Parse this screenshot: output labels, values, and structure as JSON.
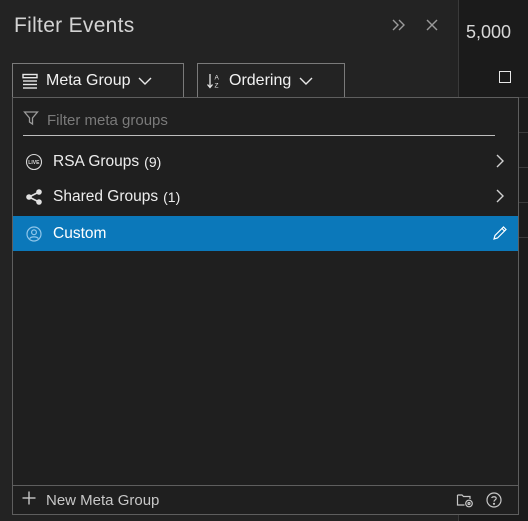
{
  "panel": {
    "title": "Filter Events",
    "expand_icon": "double-chevron-right-icon",
    "close_icon": "close-icon"
  },
  "background": {
    "count_text": "5,000"
  },
  "toolbar": {
    "meta_group_label": "Meta Group",
    "ordering_label": "Ordering"
  },
  "dropdown": {
    "filter_placeholder": "Filter meta groups",
    "items": [
      {
        "name": "RSA Groups",
        "count": "(9)",
        "icon": "live-icon",
        "trail": "chevron-right-icon"
      },
      {
        "name": "Shared Groups",
        "count": "(1)",
        "icon": "share-icon",
        "trail": "chevron-right-icon"
      },
      {
        "name": "Custom",
        "count": "",
        "icon": "user-icon",
        "trail": "pencil-icon",
        "selected": true
      }
    ],
    "footer": {
      "new_label": "New Meta Group"
    }
  },
  "colors": {
    "selected_bg": "#0b78ba",
    "panel_bg": "#232323",
    "dropdown_bg": "#1f1f1f"
  }
}
